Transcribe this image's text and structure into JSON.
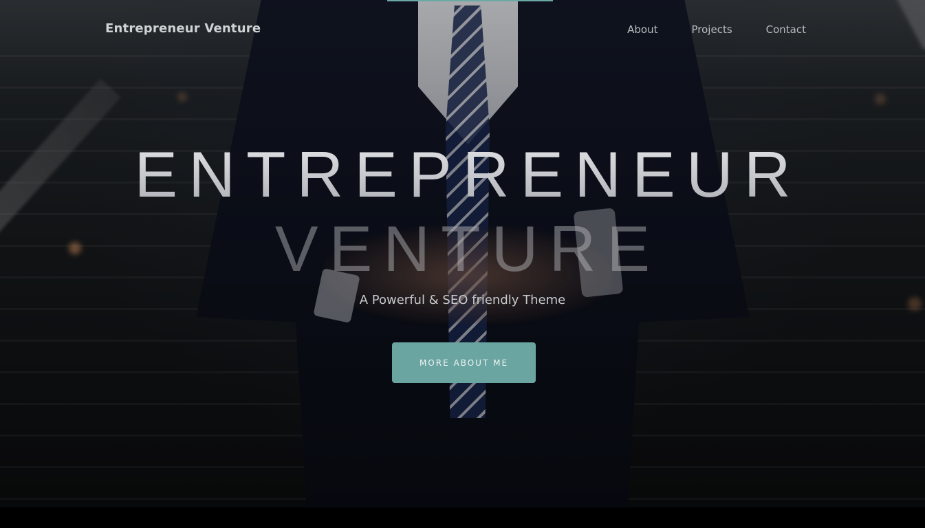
{
  "nav": {
    "brand": "Entrepreneur Venture",
    "items": [
      {
        "label": "About"
      },
      {
        "label": "Projects"
      },
      {
        "label": "Contact"
      }
    ]
  },
  "hero": {
    "headline_line1": "ENTREPRENEUR",
    "headline_line2": "VENTURE",
    "subtitle": "A Powerful & SEO friendly Theme",
    "cta_label": "MORE ABOUT ME"
  },
  "colors": {
    "accent": "#6ba5a1",
    "background": "#0b0c0d"
  }
}
